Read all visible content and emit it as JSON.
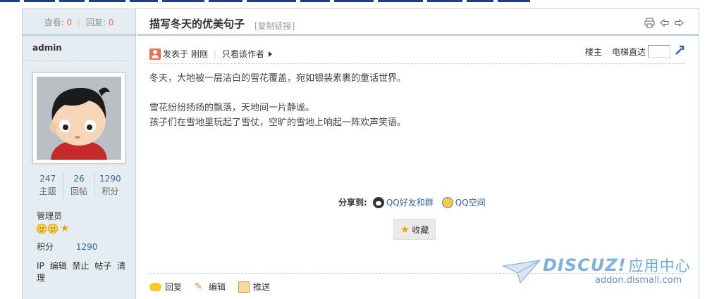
{
  "thread": {
    "views_label": "查看:",
    "views": "0",
    "replies_label": "回复:",
    "replies": "0",
    "title": "描写冬天的优美句子",
    "copy_link": "[复制链接]"
  },
  "author": {
    "name": "admin",
    "stats": [
      {
        "value": "247",
        "label": "主题"
      },
      {
        "value": "26",
        "label": "回帖"
      },
      {
        "value": "1290",
        "label": "积分"
      }
    ],
    "usergroup": "管理员",
    "credits_label": "积分",
    "credits": "1290",
    "admin_links": [
      "IP",
      "编辑",
      "禁止",
      "帖子",
      "清理"
    ]
  },
  "meta": {
    "posted": "发表于 刚刚",
    "only_author": "只看该作者",
    "floor": "楼主",
    "jump_label": "电梯直达"
  },
  "content": {
    "lines": [
      "冬天，大地被一层洁白的雪花覆盖，宛如银装素裹的童话世界。",
      "",
      "雪花纷纷扬扬的飘落，天地间一片静谧。",
      "孩子们在雪地里玩起了雪仗，空旷的雪地上响起一阵欢声笑语。"
    ]
  },
  "share": {
    "label": "分享到:",
    "qq_friends": "QQ好友和群",
    "qzone": "QQ空间"
  },
  "favorite": "收藏",
  "actions": {
    "reply": "回复",
    "edit": "编辑",
    "push": "推送"
  },
  "watermark": {
    "brand": "DISCUZ!",
    "brand_cn": "应用中心",
    "url": "addon.dismall.com"
  },
  "colors": {
    "border": "#c2d5e3",
    "sidebar_bg": "#e5edf2",
    "link": "#336699",
    "accent": "#f26c4f"
  }
}
